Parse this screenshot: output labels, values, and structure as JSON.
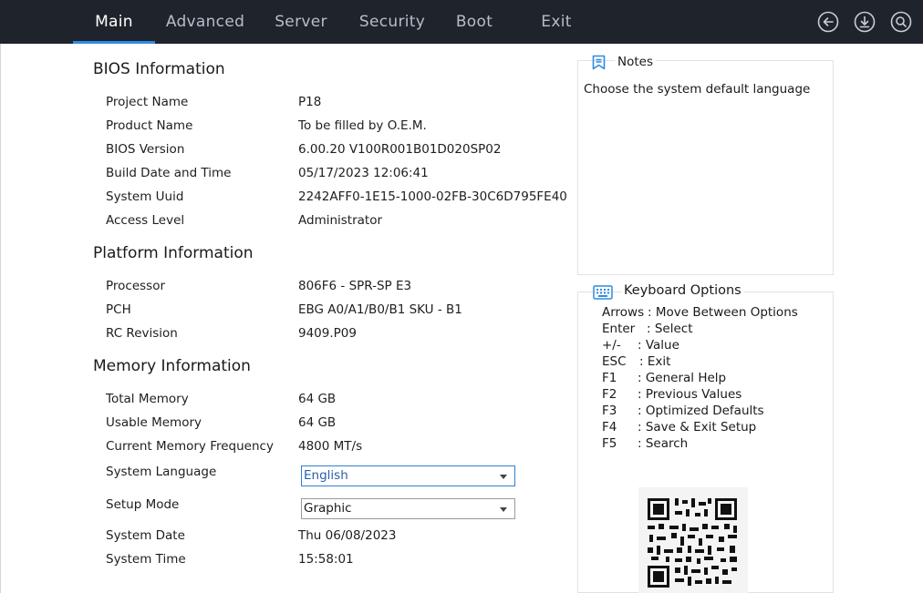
{
  "tabs": [
    "Main",
    "Advanced",
    "Server",
    "Security",
    "Boot",
    "Exit"
  ],
  "active_tab": "Main",
  "top_icons": [
    "back-arrow-icon",
    "save-download-icon",
    "search-icon"
  ],
  "sections": {
    "bios": {
      "title": "BIOS Information",
      "rows": [
        {
          "label": "Project Name",
          "value": "P18"
        },
        {
          "label": "Product Name",
          "value": "To be filled by O.E.M."
        },
        {
          "label": "BIOS Version",
          "value": "6.00.20 V100R001B01D020SP02"
        },
        {
          "label": "Build Date and Time",
          "value": "05/17/2023 12:06:41"
        },
        {
          "label": "System Uuid",
          "value": "2242AFF0-1E15-1000-02FB-30C6D795FE40"
        },
        {
          "label": "Access Level",
          "value": "Administrator"
        }
      ]
    },
    "platform": {
      "title": "Platform Information",
      "rows": [
        {
          "label": "Processor",
          "value": "806F6 - SPR-SP E3"
        },
        {
          "label": "PCH",
          "value": "EBG A0/A1/B0/B1 SKU - B1"
        },
        {
          "label": "RC Revision",
          "value": "9409.P09"
        }
      ]
    },
    "memory": {
      "title": "Memory Information",
      "rows": [
        {
          "label": "Total Memory",
          "value": "64 GB"
        },
        {
          "label": "Usable Memory",
          "value": "64 GB"
        },
        {
          "label": "Current Memory Frequency",
          "value": "4800 MT/s"
        }
      ]
    }
  },
  "system_language": {
    "label": "System Language",
    "value": "English"
  },
  "setup_mode": {
    "label": "Setup Mode",
    "value": "Graphic"
  },
  "system_date": {
    "label": "System Date",
    "value": "Thu 06/08/2023"
  },
  "system_time": {
    "label": "System Time",
    "value": "15:58:01"
  },
  "notes": {
    "title": "Notes",
    "text": "Choose the system default language"
  },
  "keyboard": {
    "title": "Keyboard Options",
    "items": [
      {
        "key": "Arrows",
        "desc": ": Move Between Options"
      },
      {
        "key": "Enter",
        "desc": ": Select"
      },
      {
        "key": "+/-",
        "desc": ": Value"
      },
      {
        "key": "ESC",
        "desc": ": Exit"
      },
      {
        "key": "F1",
        "desc": ": General Help"
      },
      {
        "key": "F2",
        "desc": ": Previous Values"
      },
      {
        "key": "F3",
        "desc": ": Optimized Defaults"
      },
      {
        "key": "F4",
        "desc": ": Save & Exit Setup"
      },
      {
        "key": "F5",
        "desc": ": Search"
      }
    ]
  },
  "colors": {
    "topbar": "#1f232b",
    "accent": "#2f8be0",
    "focus_border": "#2f7fd6"
  }
}
